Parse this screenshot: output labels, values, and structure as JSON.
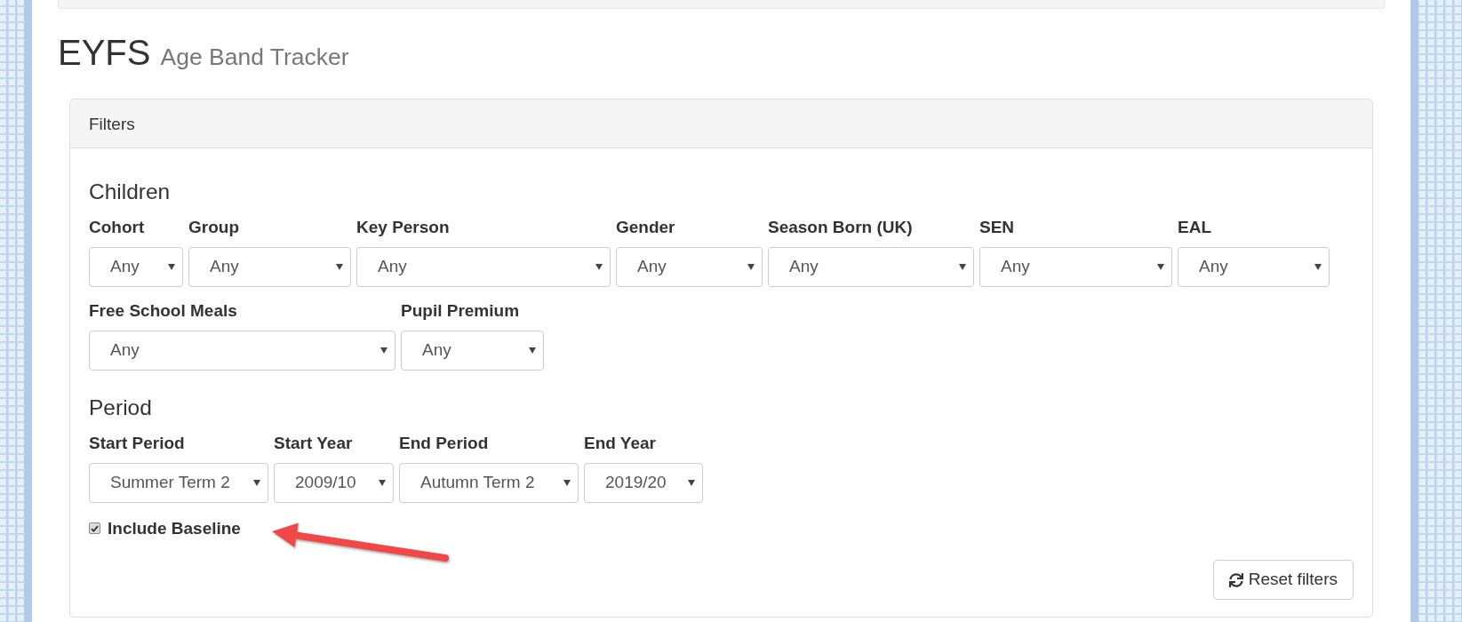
{
  "page_header": {
    "title": "EYFS",
    "subtitle": "Age Band Tracker"
  },
  "filters_panel": {
    "heading": "Filters",
    "sections": [
      {
        "title": "Children",
        "fields": [
          {
            "label": "Cohort",
            "value": "Any"
          },
          {
            "label": "Group",
            "value": "Any"
          },
          {
            "label": "Key Person",
            "value": "Any"
          },
          {
            "label": "Gender",
            "value": "Any"
          },
          {
            "label": "Season Born (UK)",
            "value": "Any"
          },
          {
            "label": "SEN",
            "value": "Any"
          },
          {
            "label": "EAL",
            "value": "Any"
          },
          {
            "label": "Free School Meals",
            "value": "Any"
          },
          {
            "label": "Pupil Premium",
            "value": "Any"
          }
        ]
      },
      {
        "title": "Period",
        "fields": [
          {
            "label": "Start Period",
            "value": "Summer Term 2"
          },
          {
            "label": "Start Year",
            "value": "2009/10"
          },
          {
            "label": "End Period",
            "value": "Autumn Term 2"
          },
          {
            "label": "End Year",
            "value": "2019/20"
          }
        ]
      }
    ],
    "include_baseline": {
      "label": "Include Baseline",
      "checked": true
    },
    "reset_button": {
      "label": "Reset filters"
    }
  }
}
